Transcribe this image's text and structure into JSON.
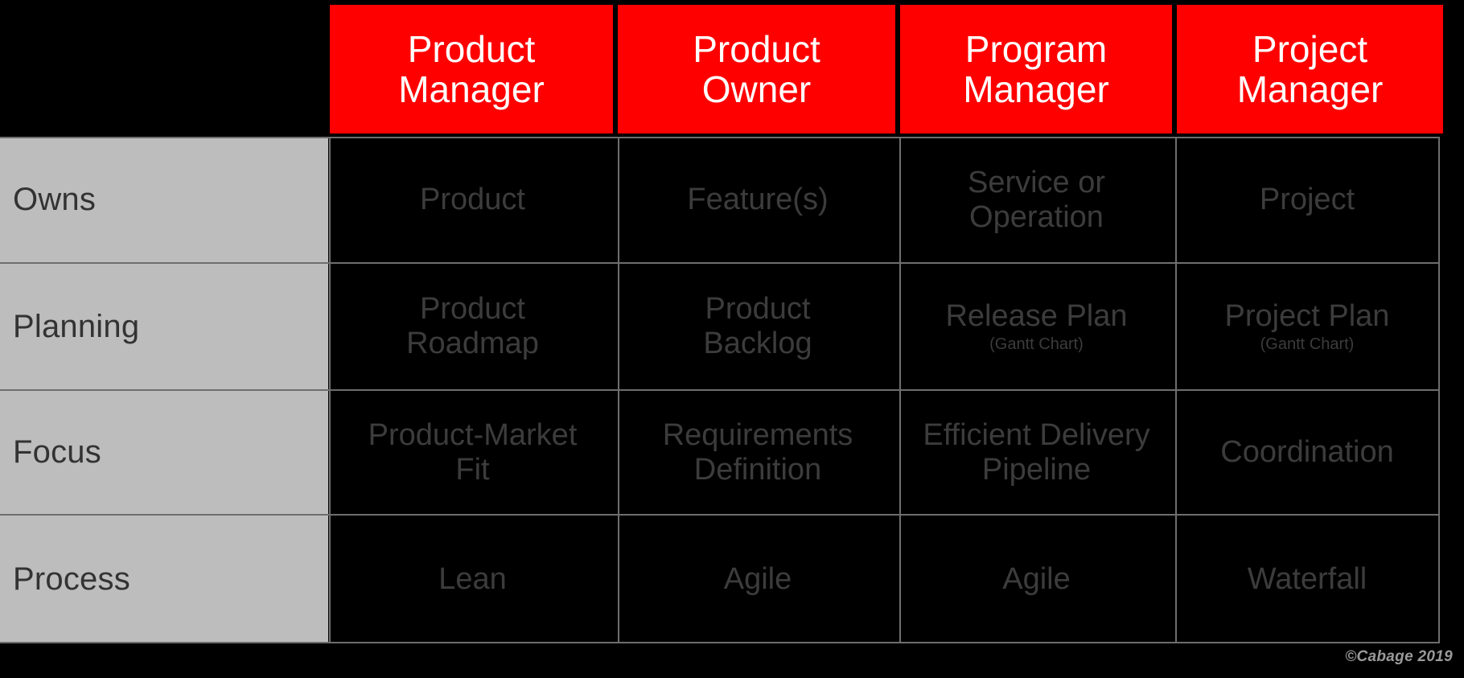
{
  "table": {
    "corner_label": "",
    "columns": [
      {
        "id": "product-manager",
        "line1": "Product",
        "line2": "Manager"
      },
      {
        "id": "product-owner",
        "line1": "Product",
        "line2": "Owner"
      },
      {
        "id": "program-manager",
        "line1": "Program",
        "line2": "Manager"
      },
      {
        "id": "project-manager",
        "line1": "Project",
        "line2": "Manager"
      }
    ],
    "rows": [
      {
        "id": "owns",
        "label": "Owns",
        "cells": [
          {
            "line1": "Product",
            "line2": "",
            "sub": ""
          },
          {
            "line1": "Feature(s)",
            "line2": "",
            "sub": ""
          },
          {
            "line1": "Service or",
            "line2": "Operation",
            "sub": ""
          },
          {
            "line1": "Project",
            "line2": "",
            "sub": ""
          }
        ]
      },
      {
        "id": "planning",
        "label": "Planning",
        "cells": [
          {
            "line1": "Product",
            "line2": "Roadmap",
            "sub": ""
          },
          {
            "line1": "Product",
            "line2": "Backlog",
            "sub": ""
          },
          {
            "line1": "Release Plan",
            "line2": "",
            "sub": "(Gantt Chart)"
          },
          {
            "line1": "Project  Plan",
            "line2": "",
            "sub": "(Gantt Chart)"
          }
        ]
      },
      {
        "id": "focus",
        "label": "Focus",
        "cells": [
          {
            "line1": "Product-Market",
            "line2": "Fit",
            "sub": ""
          },
          {
            "line1": "Requirements",
            "line2": "Definition",
            "sub": ""
          },
          {
            "line1": "Efficient Delivery",
            "line2": "Pipeline",
            "sub": ""
          },
          {
            "line1": "Coordination",
            "line2": "",
            "sub": ""
          }
        ]
      },
      {
        "id": "process",
        "label": "Process",
        "cells": [
          {
            "line1": "Lean",
            "line2": "",
            "sub": ""
          },
          {
            "line1": "Agile",
            "line2": "",
            "sub": ""
          },
          {
            "line1": "Agile",
            "line2": "",
            "sub": ""
          },
          {
            "line1": "Waterfall",
            "line2": "",
            "sub": ""
          }
        ]
      }
    ]
  },
  "footer": {
    "credit": "©Cabage 2019"
  },
  "colors": {
    "background": "#000000",
    "header_bg": "#FF0000",
    "header_text": "#FFFFFF",
    "label_bg": "#BDBDBD",
    "label_text": "#333333",
    "cell_text": "#3C3C3C",
    "grid_line": "#6E6E6E",
    "credit_text": "#9A9A9A"
  }
}
